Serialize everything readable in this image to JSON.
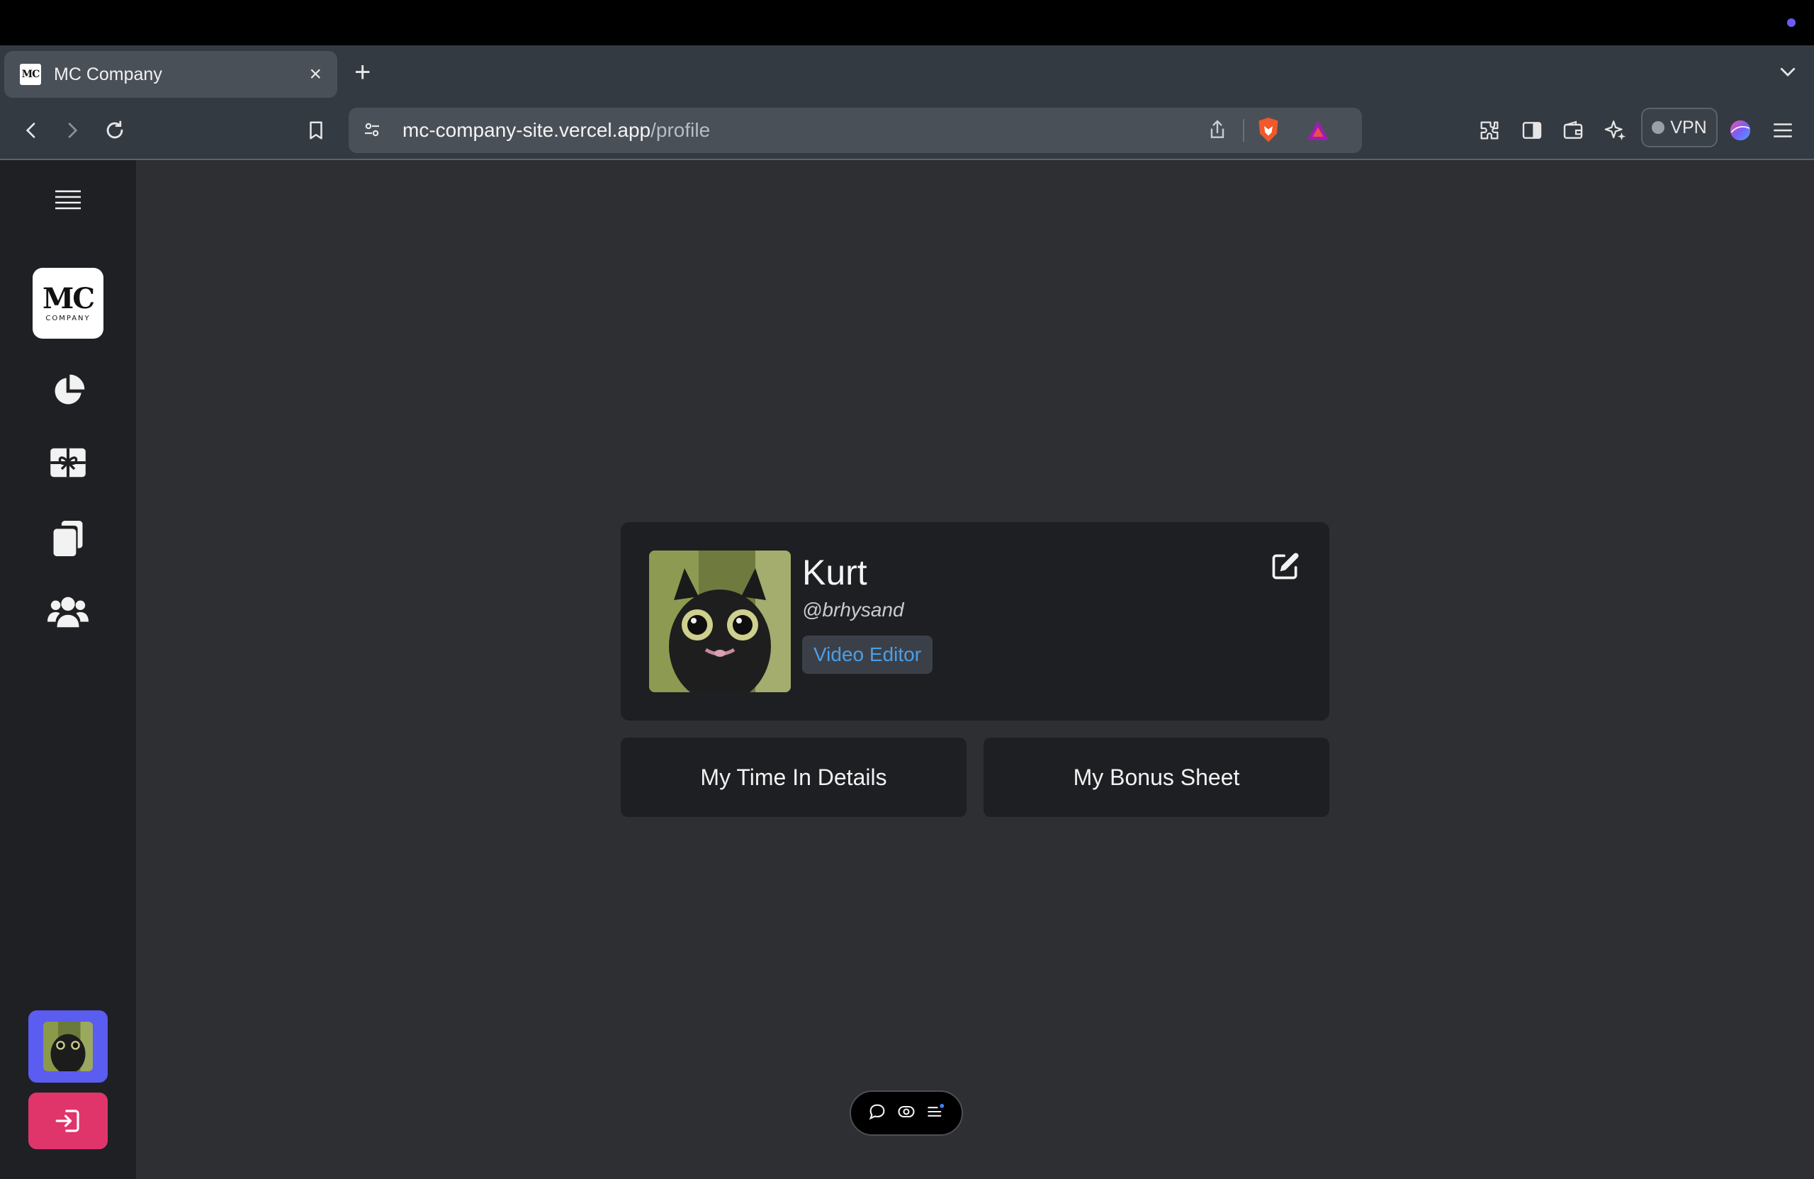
{
  "browser": {
    "tab_title": "MC Company",
    "tab_close": "×",
    "new_tab": "+",
    "favicon_text": "MC",
    "url_host": "mc-company-site.vercel.app",
    "url_path": "/profile",
    "vpn_label": "VPN"
  },
  "sidebar": {
    "logo_main": "MC",
    "logo_sub": "COMPANY",
    "items": [
      {
        "icon": "menu-icon"
      },
      {
        "icon": "logo"
      },
      {
        "icon": "pie-chart-icon"
      },
      {
        "icon": "gift-icon"
      },
      {
        "icon": "copy-icon"
      },
      {
        "icon": "users-icon"
      }
    ]
  },
  "profile": {
    "name": "Kurt",
    "handle": "@brhysand",
    "role": "Video Editor"
  },
  "actions": {
    "time_details": "My Time In Details",
    "bonus_sheet": "My Bonus Sheet"
  },
  "colors": {
    "accent": "#5b5cf0",
    "logout": "#e0356b",
    "role_text": "#4c9ee6",
    "background": "#2e2f33",
    "card": "#1e1f23"
  }
}
